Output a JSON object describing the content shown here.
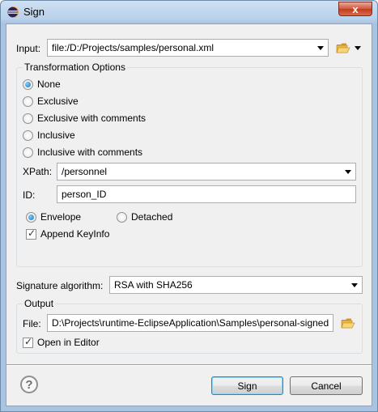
{
  "window": {
    "title": "Sign",
    "close_label": "x"
  },
  "input": {
    "label": "Input:",
    "value": "file:/D:/Projects/samples/personal.xml"
  },
  "transformation": {
    "group_title": "Transformation Options",
    "options": [
      {
        "label": "None",
        "selected": true
      },
      {
        "label": "Exclusive",
        "selected": false
      },
      {
        "label": "Exclusive with comments",
        "selected": false
      },
      {
        "label": "Inclusive",
        "selected": false
      },
      {
        "label": "Inclusive with comments",
        "selected": false
      }
    ],
    "xpath_label": "XPath:",
    "xpath_value": "/personnel",
    "id_label": "ID:",
    "id_value": "person_ID",
    "envelope_label": "Envelope",
    "detached_label": "Detached",
    "append_keyinfo_label": "Append KeyInfo",
    "append_keyinfo_checked": true
  },
  "signature": {
    "label": "Signature algorithm:",
    "value": "RSA with SHA256"
  },
  "output": {
    "group_title": "Output",
    "file_label": "File:",
    "file_value": "D:\\Projects\\runtime-EclipseApplication\\Samples\\personal-signed",
    "open_in_editor_label": "Open in Editor",
    "open_in_editor_checked": true
  },
  "footer": {
    "help_label": "?",
    "sign_label": "Sign",
    "cancel_label": "Cancel"
  },
  "colors": {
    "accent": "#3c7fb1",
    "folder": "#e8b84a",
    "title_bar": "#b9d1ea"
  }
}
